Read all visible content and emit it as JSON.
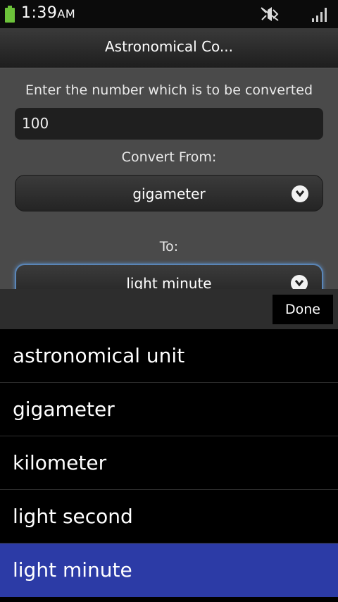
{
  "status_bar": {
    "time": "1:39",
    "ampm": "AM",
    "icons": [
      "battery-icon",
      "mute-icon",
      "signal-icon"
    ],
    "battery_color": "#6cc23a"
  },
  "app": {
    "title": "Astronomical Co..."
  },
  "form": {
    "prompt": "Enter the number which is to be converted",
    "number_value": "100",
    "convert_from_label": "Convert From:",
    "convert_from_value": "gigameter",
    "to_label": "To:",
    "to_value": "light minute"
  },
  "picker": {
    "done_label": "Done",
    "items": [
      {
        "label": "astronomical unit",
        "selected": false
      },
      {
        "label": "gigameter",
        "selected": false
      },
      {
        "label": "kilometer",
        "selected": false
      },
      {
        "label": "light second",
        "selected": false
      },
      {
        "label": "light minute",
        "selected": true
      }
    ],
    "selected_color": "#2c3ba6"
  }
}
